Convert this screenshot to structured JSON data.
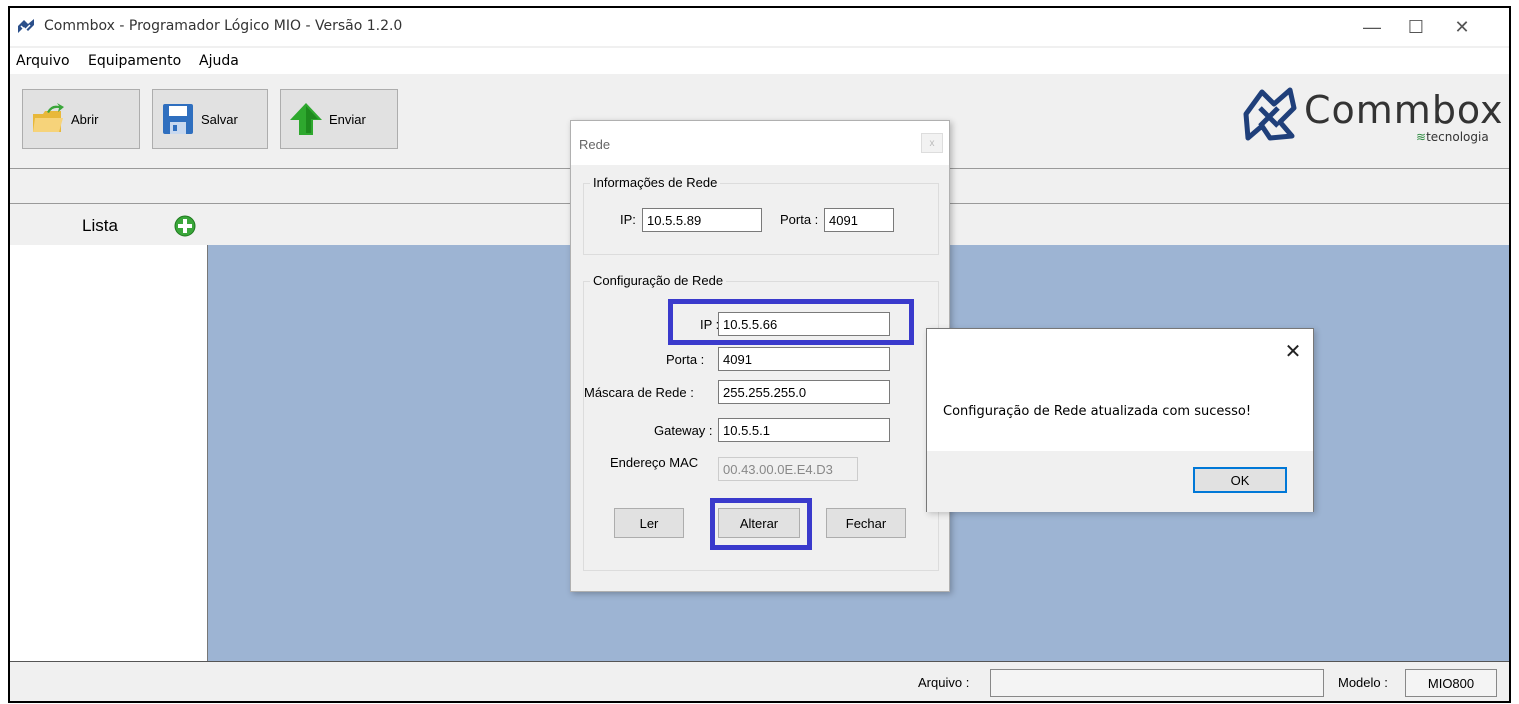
{
  "window": {
    "title": "Commbox - Programador Lógico MIO - Versão 1.2.0",
    "controls": {
      "minimize": "—",
      "maximize": "☐",
      "close": "✕"
    }
  },
  "menu": {
    "items": [
      "Arquivo",
      "Equipamento",
      "Ajuda"
    ]
  },
  "toolbar": {
    "open_label": "Abrir",
    "save_label": "Salvar",
    "send_label": "Enviar"
  },
  "brand": {
    "name": "Commbox",
    "sub_prefix": "≋",
    "sub": "tecnologia"
  },
  "sidebar": {
    "lista_label": "Lista"
  },
  "status": {
    "arquivo_label": "Arquivo :",
    "arquivo_value": "",
    "modelo_label": "Modelo :",
    "modelo_value": "MIO800"
  },
  "rede_dialog": {
    "title": "Rede",
    "close": "x",
    "info_group": {
      "title": "Informações de Rede",
      "ip_label": "IP:",
      "ip_value": "10.5.5.89",
      "porta_label": "Porta :",
      "porta_value": "4091"
    },
    "config_group": {
      "title": "Configuração de Rede",
      "ip_label": "IP :",
      "ip_value": "10.5.5.66",
      "porta_label": "Porta :",
      "porta_value": "4091",
      "mask_label": "Máscara de Rede :",
      "mask_value": "255.255.255.0",
      "gateway_label": "Gateway :",
      "gateway_value": "10.5.5.1",
      "mac_label": "Endereço MAC",
      "mac_value": "00.43.00.0E.E4.D3"
    },
    "buttons": {
      "read": "Ler",
      "change": "Alterar",
      "close": "Fechar"
    }
  },
  "message_box": {
    "text": "Configuração de Rede atualizada com sucesso!",
    "close": "✕",
    "ok": "OK"
  },
  "colors": {
    "workspace": "#9db4d3",
    "highlight": "#3a3acc",
    "ok_border": "#0078d7"
  }
}
